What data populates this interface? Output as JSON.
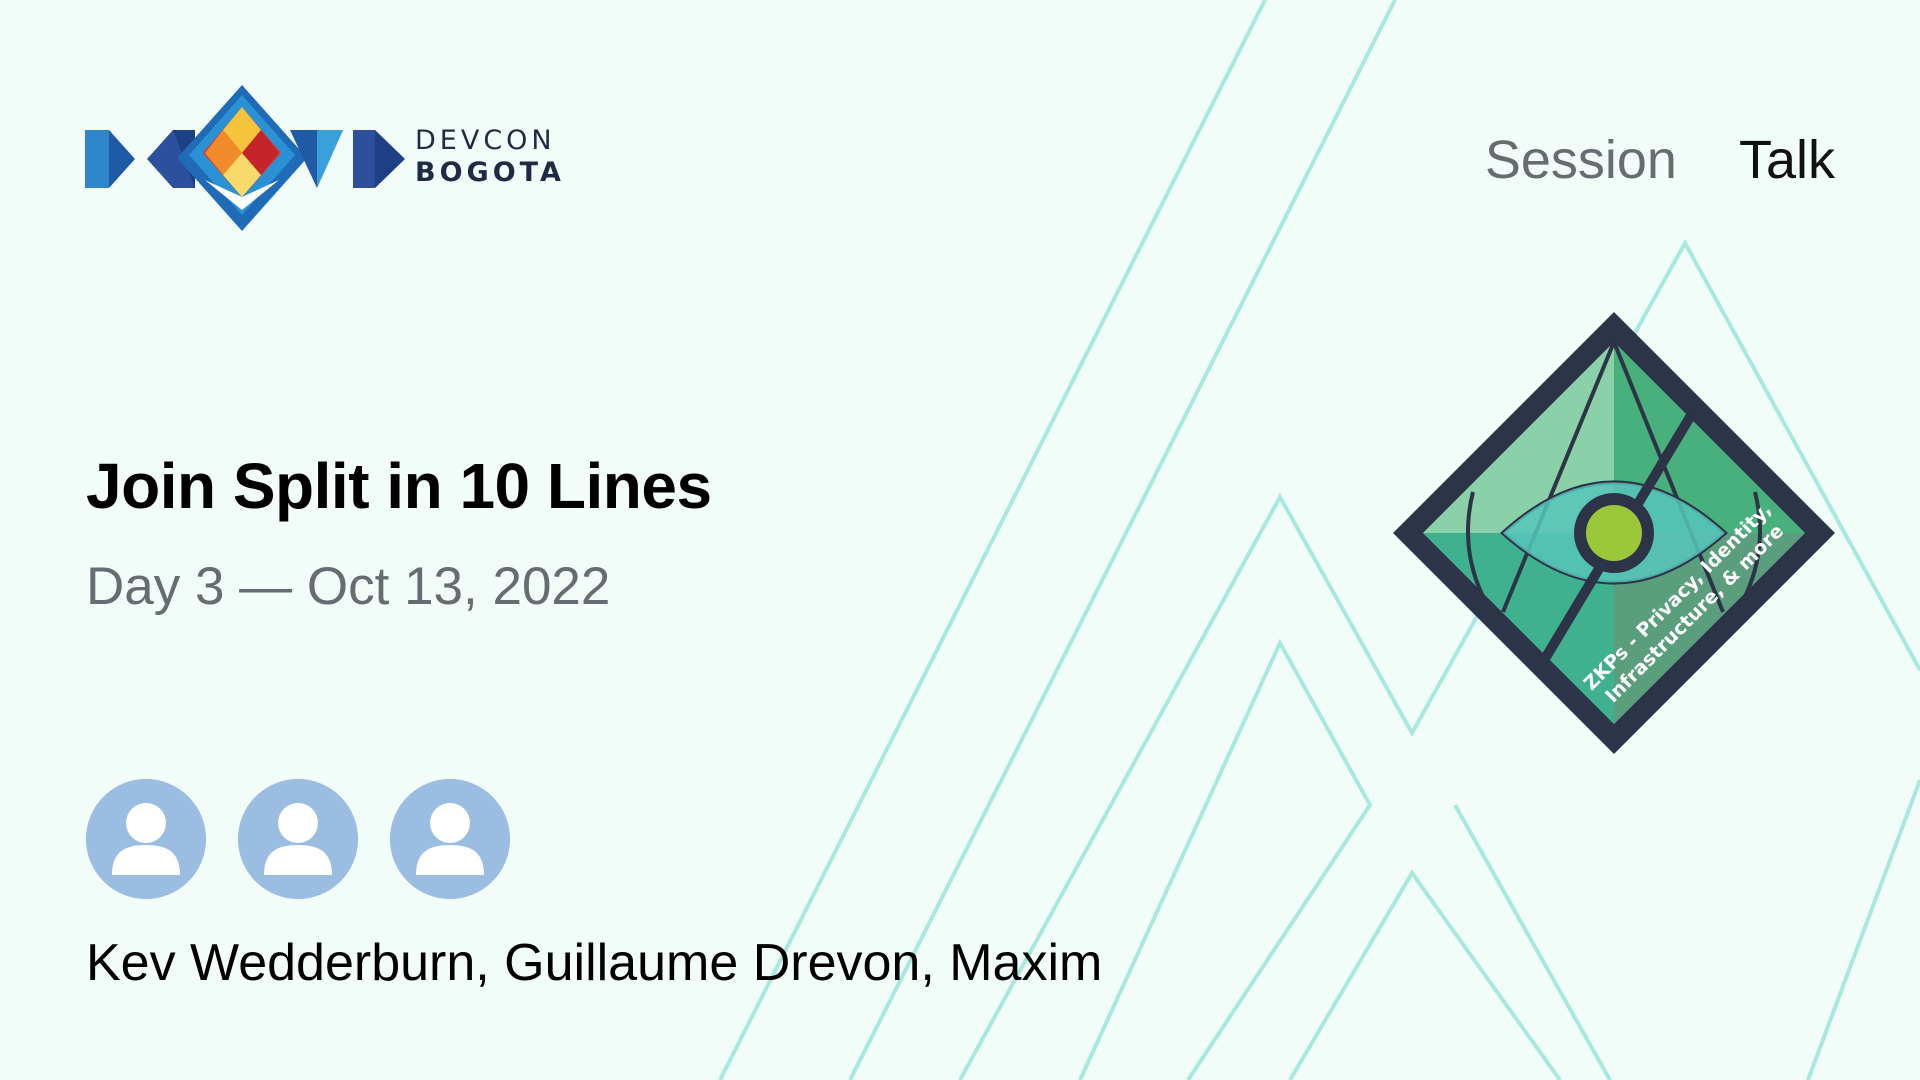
{
  "brand": {
    "line1": "DEVCON",
    "line2": "BOGOTA"
  },
  "header": {
    "type_tag": "Session",
    "format_tag": "Talk"
  },
  "session": {
    "title": "Join Split in 10 Lines",
    "date": "Day 3 — Oct 13, 2022",
    "speakers": "Kev Wedderburn, Guillaume Drevon, Maxim"
  },
  "avatars": [
    {
      "icon": "user-icon"
    },
    {
      "icon": "user-icon"
    },
    {
      "icon": "user-icon"
    }
  ],
  "track": {
    "line1": "ZKPs - Privacy, Identity,",
    "line2": "Infrastructure, & more",
    "icon": "eye-icon"
  },
  "colors": {
    "background": "#f2fdfa",
    "accent_lines": "#a8e8df",
    "avatar": "#9bbde2",
    "title": "#000000",
    "muted": "#666c70",
    "badge_frame": "#2e3448"
  }
}
